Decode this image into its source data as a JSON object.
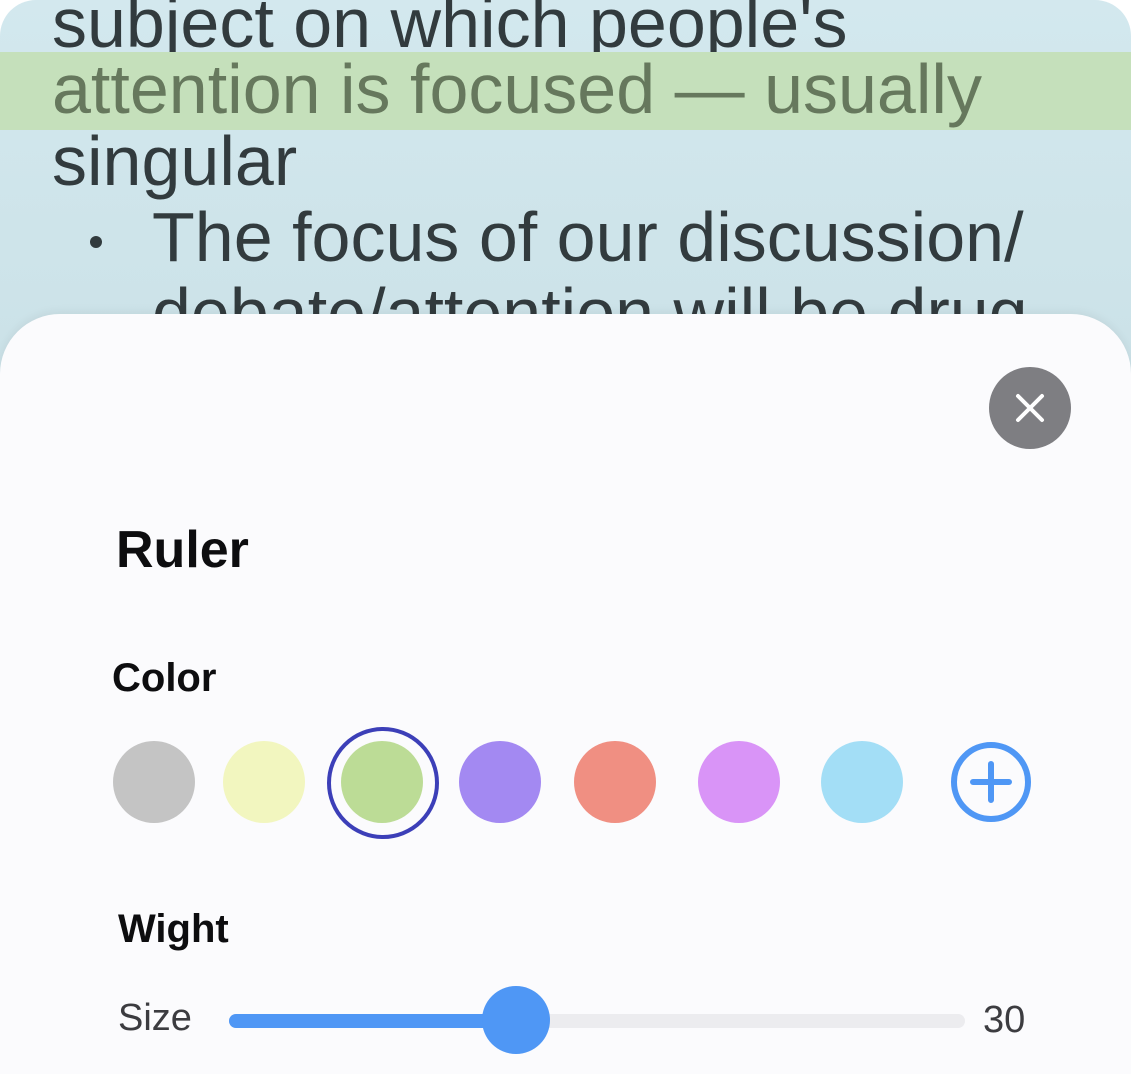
{
  "background_text": {
    "line1": "subject on which people's",
    "line2_highlighted": "attention is focused — usually",
    "line3": "singular",
    "bullet_line1": "The focus of our discussion/",
    "bullet_line2": "debate/attention will be drug"
  },
  "panel": {
    "title": "Ruler",
    "close_icon": "close-icon",
    "color_section": {
      "label": "Color",
      "swatches": [
        {
          "name": "gray",
          "color": "#c4c4c4"
        },
        {
          "name": "light-yellow",
          "color": "#f2f6bf"
        },
        {
          "name": "light-green",
          "color": "#bcdc96",
          "selected": true
        },
        {
          "name": "purple",
          "color": "#a389f2"
        },
        {
          "name": "salmon",
          "color": "#f08f82"
        },
        {
          "name": "violet",
          "color": "#d994f7"
        },
        {
          "name": "light-blue",
          "color": "#a3def6"
        }
      ],
      "add_icon": "plus-circle-icon"
    },
    "weight_section": {
      "label": "Wight",
      "size_label": "Size",
      "size_value": "30",
      "slider_fraction": 0.39
    }
  },
  "colors": {
    "accent": "#4f97f5",
    "selection_ring": "#3c3fb8",
    "highlight": "#c5e0bb"
  }
}
